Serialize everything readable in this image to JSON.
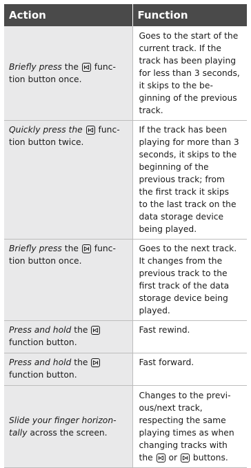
{
  "table": {
    "headers": {
      "action": "Action",
      "function": "Function"
    },
    "rows": [
      {
        "action_em": "Briefly press",
        "action_mid": " the ",
        "icon": "previous-track-icon",
        "action_rest": " func­tion button once.",
        "function": "Goes to the start of the cur­rent track. If the track has been playing for less than 3 seconds, it skips to the be­ginning of the previous track."
      },
      {
        "action_em": "Quickly press the",
        "action_mid": " ",
        "icon": "previous-track-icon",
        "action_rest": " func­tion button twice.",
        "function": "If the track has been play­ing for more than 3 sec­onds, it skips to the begin­ning of the previous track; from the first track it skips to the last track on the data storage device being played."
      },
      {
        "action_em": "Briefly press",
        "action_mid": " the ",
        "icon": "next-track-icon",
        "action_rest": " func­tion button once.",
        "function": "Goes to the next track. It changes from the previous track to the first track of the data storage device being played."
      },
      {
        "action_em": "Press and hold",
        "action_mid": " the ",
        "icon": "previous-track-icon",
        "action_rest": " function button.",
        "function": "Fast rewind."
      },
      {
        "action_em": "Press and hold",
        "action_mid": " the ",
        "icon": "next-track-icon",
        "action_rest": " function button.",
        "function": "Fast forward."
      },
      {
        "action_em": "Slide your finger horizon­tally",
        "action_rest": " across the screen.",
        "function_pre": "Changes to the previ­ous/next track, respecting the same playing times as when changing tracks with the ",
        "function_or": " or ",
        "function_post": " buttons."
      }
    ]
  }
}
